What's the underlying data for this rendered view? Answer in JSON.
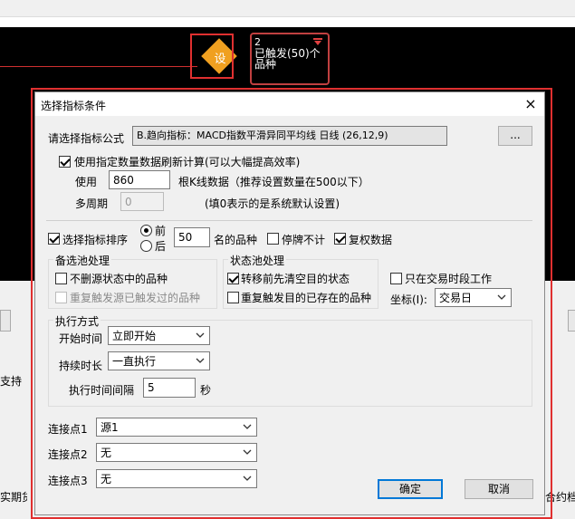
{
  "canvas": {
    "node_label": "设",
    "output_number": "2",
    "output_line1": "已触发(50)个",
    "output_line2": "品种",
    "bg_left_text": "支持",
    "bg_bottom_left": "实期货",
    "bg_bottom_right": "综合约档"
  },
  "dialog": {
    "title": "选择指标条件",
    "close": "×",
    "formula_label": "请选择指标公式",
    "formula_value": "B.趋向指标：MACD指数平滑异同平均线 日线 (26,12,9)",
    "browse_button": "...",
    "use_count_checkbox": "使用指定数量数据刷新计算(可以大幅提高效率)",
    "use_label": "使用",
    "use_value": "860",
    "bars_label": "根K线数据（推荐设置数量在500以下）",
    "multi_period_label": "多周期",
    "multi_period_value": "0",
    "multi_period_hint": "(填0表示的是系统默认设置)",
    "sort_checkbox": "选择指标排序",
    "radio_front": "前",
    "radio_back": "后",
    "top_n_value": "50",
    "top_n_suffix": "名的品种",
    "suspend_checkbox": "停牌不计",
    "restore_checkbox": "复权数据",
    "candidate_group": "备选池处理",
    "no_delete_checkbox": "不删源状态中的品种",
    "retrigger_checkbox": "重复触发源已触发过的品种",
    "state_group": "状态池处理",
    "clear_target_checkbox": "转移前先清空目的状态",
    "retrigger_target_checkbox": "重复触发目的已存在的品种",
    "trading_time_checkbox": "只在交易时段工作",
    "axis_label": "坐标(I):",
    "axis_value": "交易日",
    "exec_group": "执行方式",
    "start_label": "开始时间",
    "start_value": "立即开始",
    "duration_label": "持续时长",
    "duration_value": "一直执行",
    "interval_label": "执行时间间隔",
    "interval_value": "5",
    "interval_unit": "秒",
    "conn1_label": "连接点1",
    "conn1_value": "源1",
    "conn2_label": "连接点2",
    "conn2_value": "无",
    "conn3_label": "连接点3",
    "conn3_value": "无",
    "ok_button": "确定",
    "cancel_button": "取消"
  },
  "colors": {
    "highlight": "#e03030",
    "node_fill": "#f0a020",
    "focus_border": "#0078d7"
  }
}
